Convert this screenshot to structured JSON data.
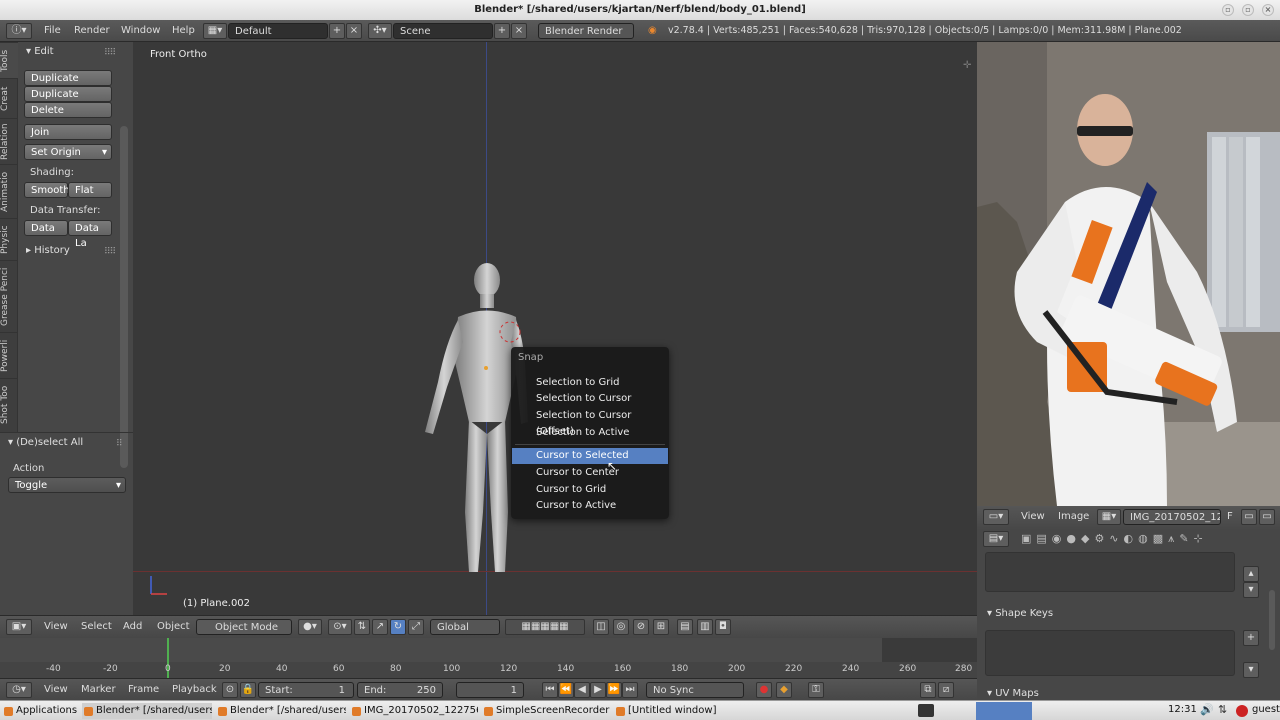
{
  "window": {
    "title": "Blender* [/shared/users/kjartan/Nerf/blend/body_01.blend]"
  },
  "topbar": {
    "menus": [
      "File",
      "Render",
      "Window",
      "Help"
    ],
    "layout": "Default",
    "scene": "Scene",
    "engine": "Blender Render",
    "stats": "v2.78.4 | Verts:485,251 | Faces:540,628 | Tris:970,128 | Objects:0/5 | Lamps:0/0 | Mem:311.98M | Plane.002"
  },
  "toolshelf": {
    "tabs": [
      "Tools",
      "Creat",
      "Relation",
      "Animatio",
      "Physic",
      "Grease Penci",
      "Powerli",
      "Shot Too"
    ],
    "edit_header": "Edit",
    "buttons": {
      "duplicate": "Duplicate",
      "duplicate_linked": "Duplicate Linked",
      "delete": "Delete",
      "join": "Join",
      "set_origin": "Set Origin"
    },
    "shading_label": "Shading:",
    "smooth": "Smooth",
    "flat": "Flat",
    "data_transfer_label": "Data Transfer:",
    "data": "Data",
    "data_la": "Data La",
    "history_header": "History",
    "deselect_header": "(De)select All",
    "action_label": "Action",
    "action_value": "Toggle"
  },
  "viewport": {
    "view_name": "Front Ortho",
    "object_label": "(1) Plane.002"
  },
  "snap_menu": {
    "title": "Snap",
    "items": [
      "Selection to Grid",
      "Selection to Cursor",
      "Selection to Cursor (Offset)",
      "Selection to Active",
      "Cursor to Selected",
      "Cursor to Center",
      "Cursor to Grid",
      "Cursor to Active"
    ],
    "selected": "Cursor to Selected"
  },
  "vp_header": {
    "view": "View",
    "select": "Select",
    "add": "Add",
    "object": "Object",
    "mode": "Object Mode",
    "orientation": "Global"
  },
  "timeline": {
    "ticks": [
      "-40",
      "-20",
      "0",
      "20",
      "40",
      "60",
      "80",
      "100",
      "120",
      "140",
      "160",
      "180",
      "200",
      "220",
      "240",
      "260",
      "280"
    ],
    "view": "View",
    "marker": "Marker",
    "frame": "Frame",
    "playback": "Playback",
    "start_label": "Start:",
    "start_value": "1",
    "end_label": "End:",
    "end_value": "250",
    "current": "1",
    "sync": "No Sync"
  },
  "image_editor": {
    "view": "View",
    "image": "Image",
    "image_name": "IMG_20170502_12...",
    "f": "F"
  },
  "properties": {
    "shape_keys": "Shape Keys",
    "uv_maps": "UV Maps"
  },
  "taskbar": {
    "applications": "Applications",
    "tasks": [
      "Blender* [/shared/users/...",
      "Blender* [/shared/users/...",
      "IMG_20170502_122756.j...",
      "SimpleScreenRecorder",
      "[Untitled window]"
    ],
    "clock": "12:31",
    "user": "guest"
  }
}
